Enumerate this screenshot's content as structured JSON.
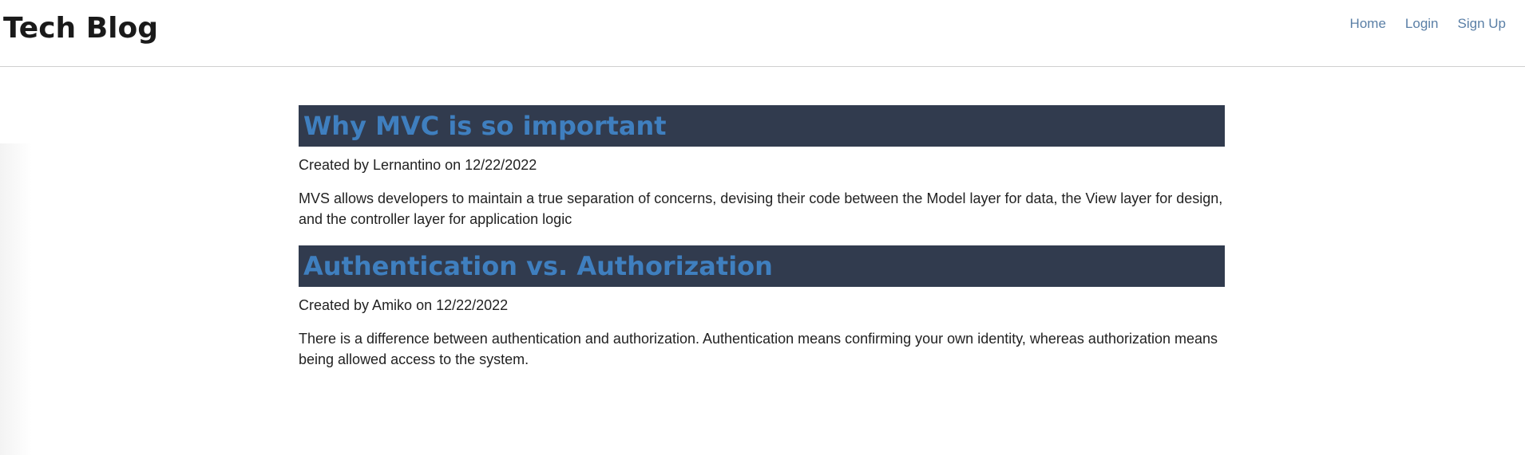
{
  "header": {
    "site_title": "Tech Blog",
    "nav": [
      {
        "label": "Home"
      },
      {
        "label": "Login"
      },
      {
        "label": "Sign Up"
      }
    ]
  },
  "posts": [
    {
      "title": "Why MVC is so important",
      "meta": "Created by Lernantino on 12/22/2022",
      "body": "MVS allows developers to maintain a true separation of concerns, devising their code between the Model layer for data, the View layer for design, and the controller layer for application logic"
    },
    {
      "title": "Authentication vs. Authorization",
      "meta": "Created by Amiko on 12/22/2022",
      "body": "There is a difference between authentication and authorization. Authentication means confirming your own identity, whereas authorization means being allowed access to the system."
    }
  ],
  "colors": {
    "title_bar_bg": "#313b4e",
    "post_title": "#3f7fbf",
    "nav_link": "#5a7fa6"
  }
}
